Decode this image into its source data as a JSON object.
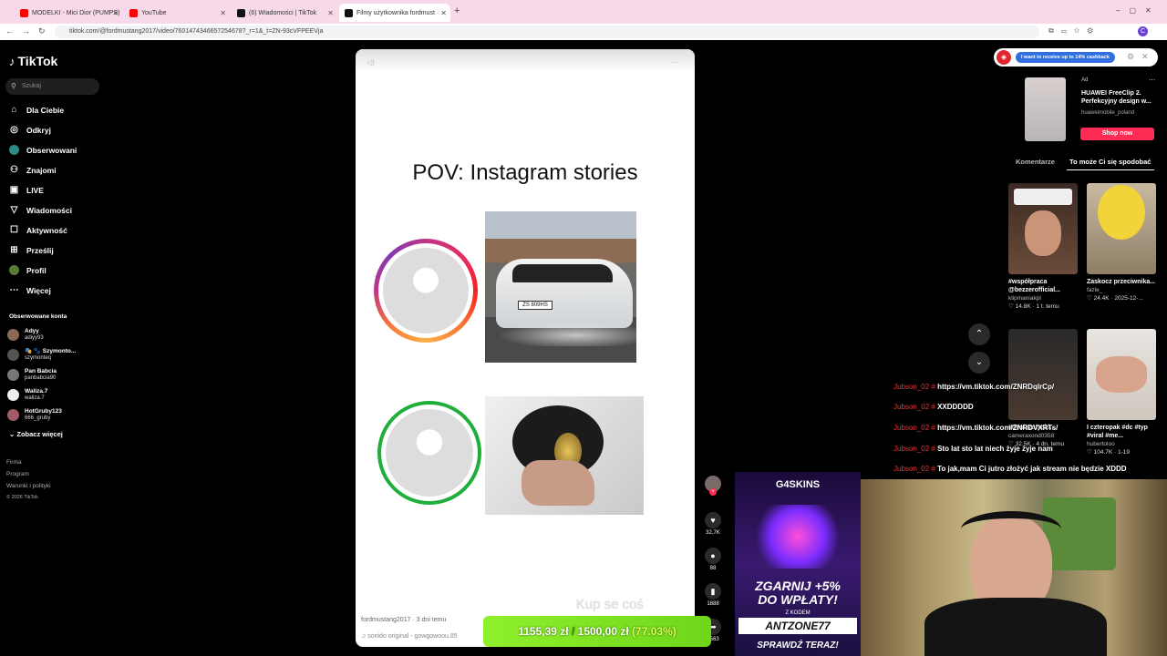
{
  "browser": {
    "tabs": [
      {
        "label": "MODELKI - Mici Dior (PUMPS)",
        "icon_color": "#ff0000"
      },
      {
        "label": "YouTube",
        "icon_color": "#ff0000"
      },
      {
        "label": "(6) Wiadomości | TikTok",
        "icon_color": "#111111"
      },
      {
        "label": "Filmy użytkownika fordmust",
        "icon_color": "#111111"
      }
    ],
    "new_tab": "+",
    "url": "tiktok.com/@fordmustang2017/video/7601474346657254678?_r=1&_t=ZN-93cVFPEEVja"
  },
  "sidebar": {
    "logo": "TikTok",
    "search_placeholder": "Szukaj",
    "nav": [
      {
        "label": "Dla Ciebie",
        "icon": "home-icon"
      },
      {
        "label": "Odkryj",
        "icon": "compass-icon"
      },
      {
        "label": "Obserwowani",
        "icon": "following-icon"
      },
      {
        "label": "Znajomi",
        "icon": "friends-icon"
      },
      {
        "label": "LIVE",
        "icon": "live-icon"
      },
      {
        "label": "Wiadomości",
        "icon": "messages-icon"
      },
      {
        "label": "Aktywność",
        "icon": "activity-icon"
      },
      {
        "label": "Prześlij",
        "icon": "upload-icon"
      },
      {
        "label": "Profil",
        "icon": "profile-icon"
      },
      {
        "label": "Więcej",
        "icon": "more-icon"
      }
    ],
    "following_header": "Obserwowane konta",
    "accounts": [
      {
        "name": "Adyy",
        "handle": "adiyy93"
      },
      {
        "name": "🎭 🐾 Szymonto...",
        "handle": "szymonteq"
      },
      {
        "name": "Pan Babcia",
        "handle": "panbabcia90"
      },
      {
        "name": "Waliza.7",
        "handle": "waliza.7"
      },
      {
        "name": "HotGruby123",
        "handle": "666_gruby"
      }
    ],
    "see_more": "Zobacz więcej",
    "footer": [
      "Firma",
      "Program",
      "Warunki i polityki",
      "© 2026 TikTok"
    ]
  },
  "video": {
    "title": "POV: Instagram stories",
    "caption": "fordmustang2017 · 3 dni temu",
    "sound": "♫ sonido original - gowgowoou.85",
    "overlay_text": "Kup se coś",
    "plate": "ZS 809HS"
  },
  "actions": {
    "likes": "32,7K",
    "comments": "88",
    "saves": "1888",
    "shares": "9563"
  },
  "ad": {
    "promo_bar": "I want to receive up to 14% cashback",
    "tag": "Ad",
    "title": "HUAWEI FreeClip 2. Perfekcyjny design w...",
    "sponsor": "huaweimobile_poland",
    "cta": "Shop now"
  },
  "right_tabs": [
    "Komentarze",
    "To może Ci się spodobać"
  ],
  "cards": [
    {
      "title": "#współpraca @bezzerofficial...",
      "user": "klipmaniakpl",
      "meta": "♡ 14.8K · 1 t. temu"
    },
    {
      "title": "Zaskocz przeciwnika...",
      "user": "fazle_",
      "meta": "♡ 24.4K · 2025-12-..."
    },
    {
      "title": "#deniszatycki...",
      "user": "cameraxond0358",
      "meta": "♡ 32.5K · 4 dn. temu"
    },
    {
      "title": "I czteropak #dc #typ #viral #me...",
      "user": "hubertoloo",
      "meta": "♡ 104.7K · 1-19"
    }
  ],
  "chat": [
    {
      "user": "Jubson_02 #",
      "msg": "https://vm.tiktok.com/ZNRDqlrCp/"
    },
    {
      "user": "Jubson_02 #",
      "msg": "XXDDDDD"
    },
    {
      "user": "Jubson_02 #",
      "msg": "https://vm.tiktok.com/ZNRDVXRTs/"
    },
    {
      "user": "Jubson_02 #",
      "msg": "Sto lat sto lat niech żyje żyje nam"
    },
    {
      "user": "Jubson_02 #",
      "msg": "To jak,mam Ci jutro złożyć jak stream nie będzie XDDD"
    }
  ],
  "donation": {
    "current": "1155,39 zł",
    "separator": "/",
    "goal": "1500,00 zł",
    "percent": "(77.03%)"
  },
  "promo": {
    "brand": "G4SKINS",
    "line1": "ZGARNIJ +5%",
    "line1b": "DO WPŁATY!",
    "with_code": "Z KODEM",
    "code": "ANTZONE77",
    "cta": "SPRAWDŹ TERAZ!"
  },
  "colors": {
    "tiktok_red": "#fe2c55",
    "donation_green": "#7ee322",
    "promo_purple": "#3a1a70"
  }
}
